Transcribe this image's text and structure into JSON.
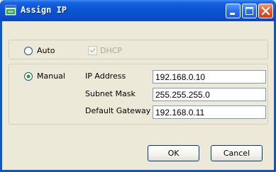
{
  "window": {
    "title": "Assign IP",
    "icon": "network-app-icon"
  },
  "mode": {
    "auto_label": "Auto",
    "auto_selected": false,
    "dhcp_label": "DHCP",
    "dhcp_checked": true,
    "dhcp_enabled": false,
    "manual_label": "Manual",
    "manual_selected": true
  },
  "fields": {
    "ip_address_label": "IP Address",
    "ip_address_value": "192.168.0.10",
    "subnet_mask_label": "Subnet Mask",
    "subnet_mask_value": "255.255.255.0",
    "default_gateway_label": "Default Gateway",
    "default_gateway_value": "192.168.0.11"
  },
  "buttons": {
    "ok_label": "OK",
    "cancel_label": "Cancel"
  },
  "colors": {
    "titlebar": "#0a4fcd",
    "close_button": "#e4572b",
    "dialog_bg": "#ece9d8",
    "disabled_text": "#aca899"
  }
}
